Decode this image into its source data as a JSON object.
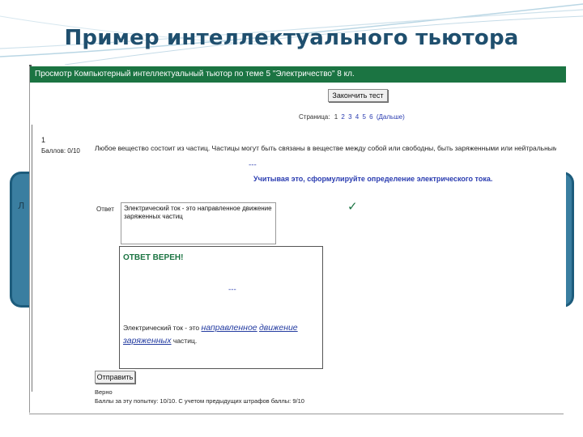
{
  "slide": {
    "title": "Пример интеллектуального тьютора",
    "left_letter": "Л"
  },
  "app": {
    "header": "Просмотр Компьютерный интеллектуальный тьютор по теме 5 \"Электричество\" 8 кл.",
    "finish_button": "Закончить тест",
    "pages_label": "Страница:",
    "current_page": "1",
    "pages": [
      "2",
      "3",
      "4",
      "5",
      "6"
    ],
    "next_link": "(Дальше)",
    "question": {
      "number": "1",
      "score": "Баллов: 0/10",
      "text": "Любое вещество состоит из частиц. Частицы могут быть связаны в веществе между собой или свободны, быть заряженными или нейтральными.",
      "separator": "---",
      "task": "Учитывая это, сформулируйте определение электрического тока.",
      "answer_label": "Ответ",
      "answer_value": "Электрический ток - это направленное движение заряженных частиц",
      "check_mark": "✓"
    },
    "feedback": {
      "title": "ОТВЕТ ВЕРЕН!",
      "separator": "---",
      "def_prefix": "Электрический ток - это",
      "def_word1": "направленное",
      "def_word2": "движение",
      "def_word3": "заряженных",
      "def_suffix": "частиц."
    },
    "send_button": "Отправить",
    "footer_line1": "Верно",
    "footer_line2": "Баллы за эту попытку: 10/10. С учетом предыдущих штрафов баллы: 9/10"
  }
}
